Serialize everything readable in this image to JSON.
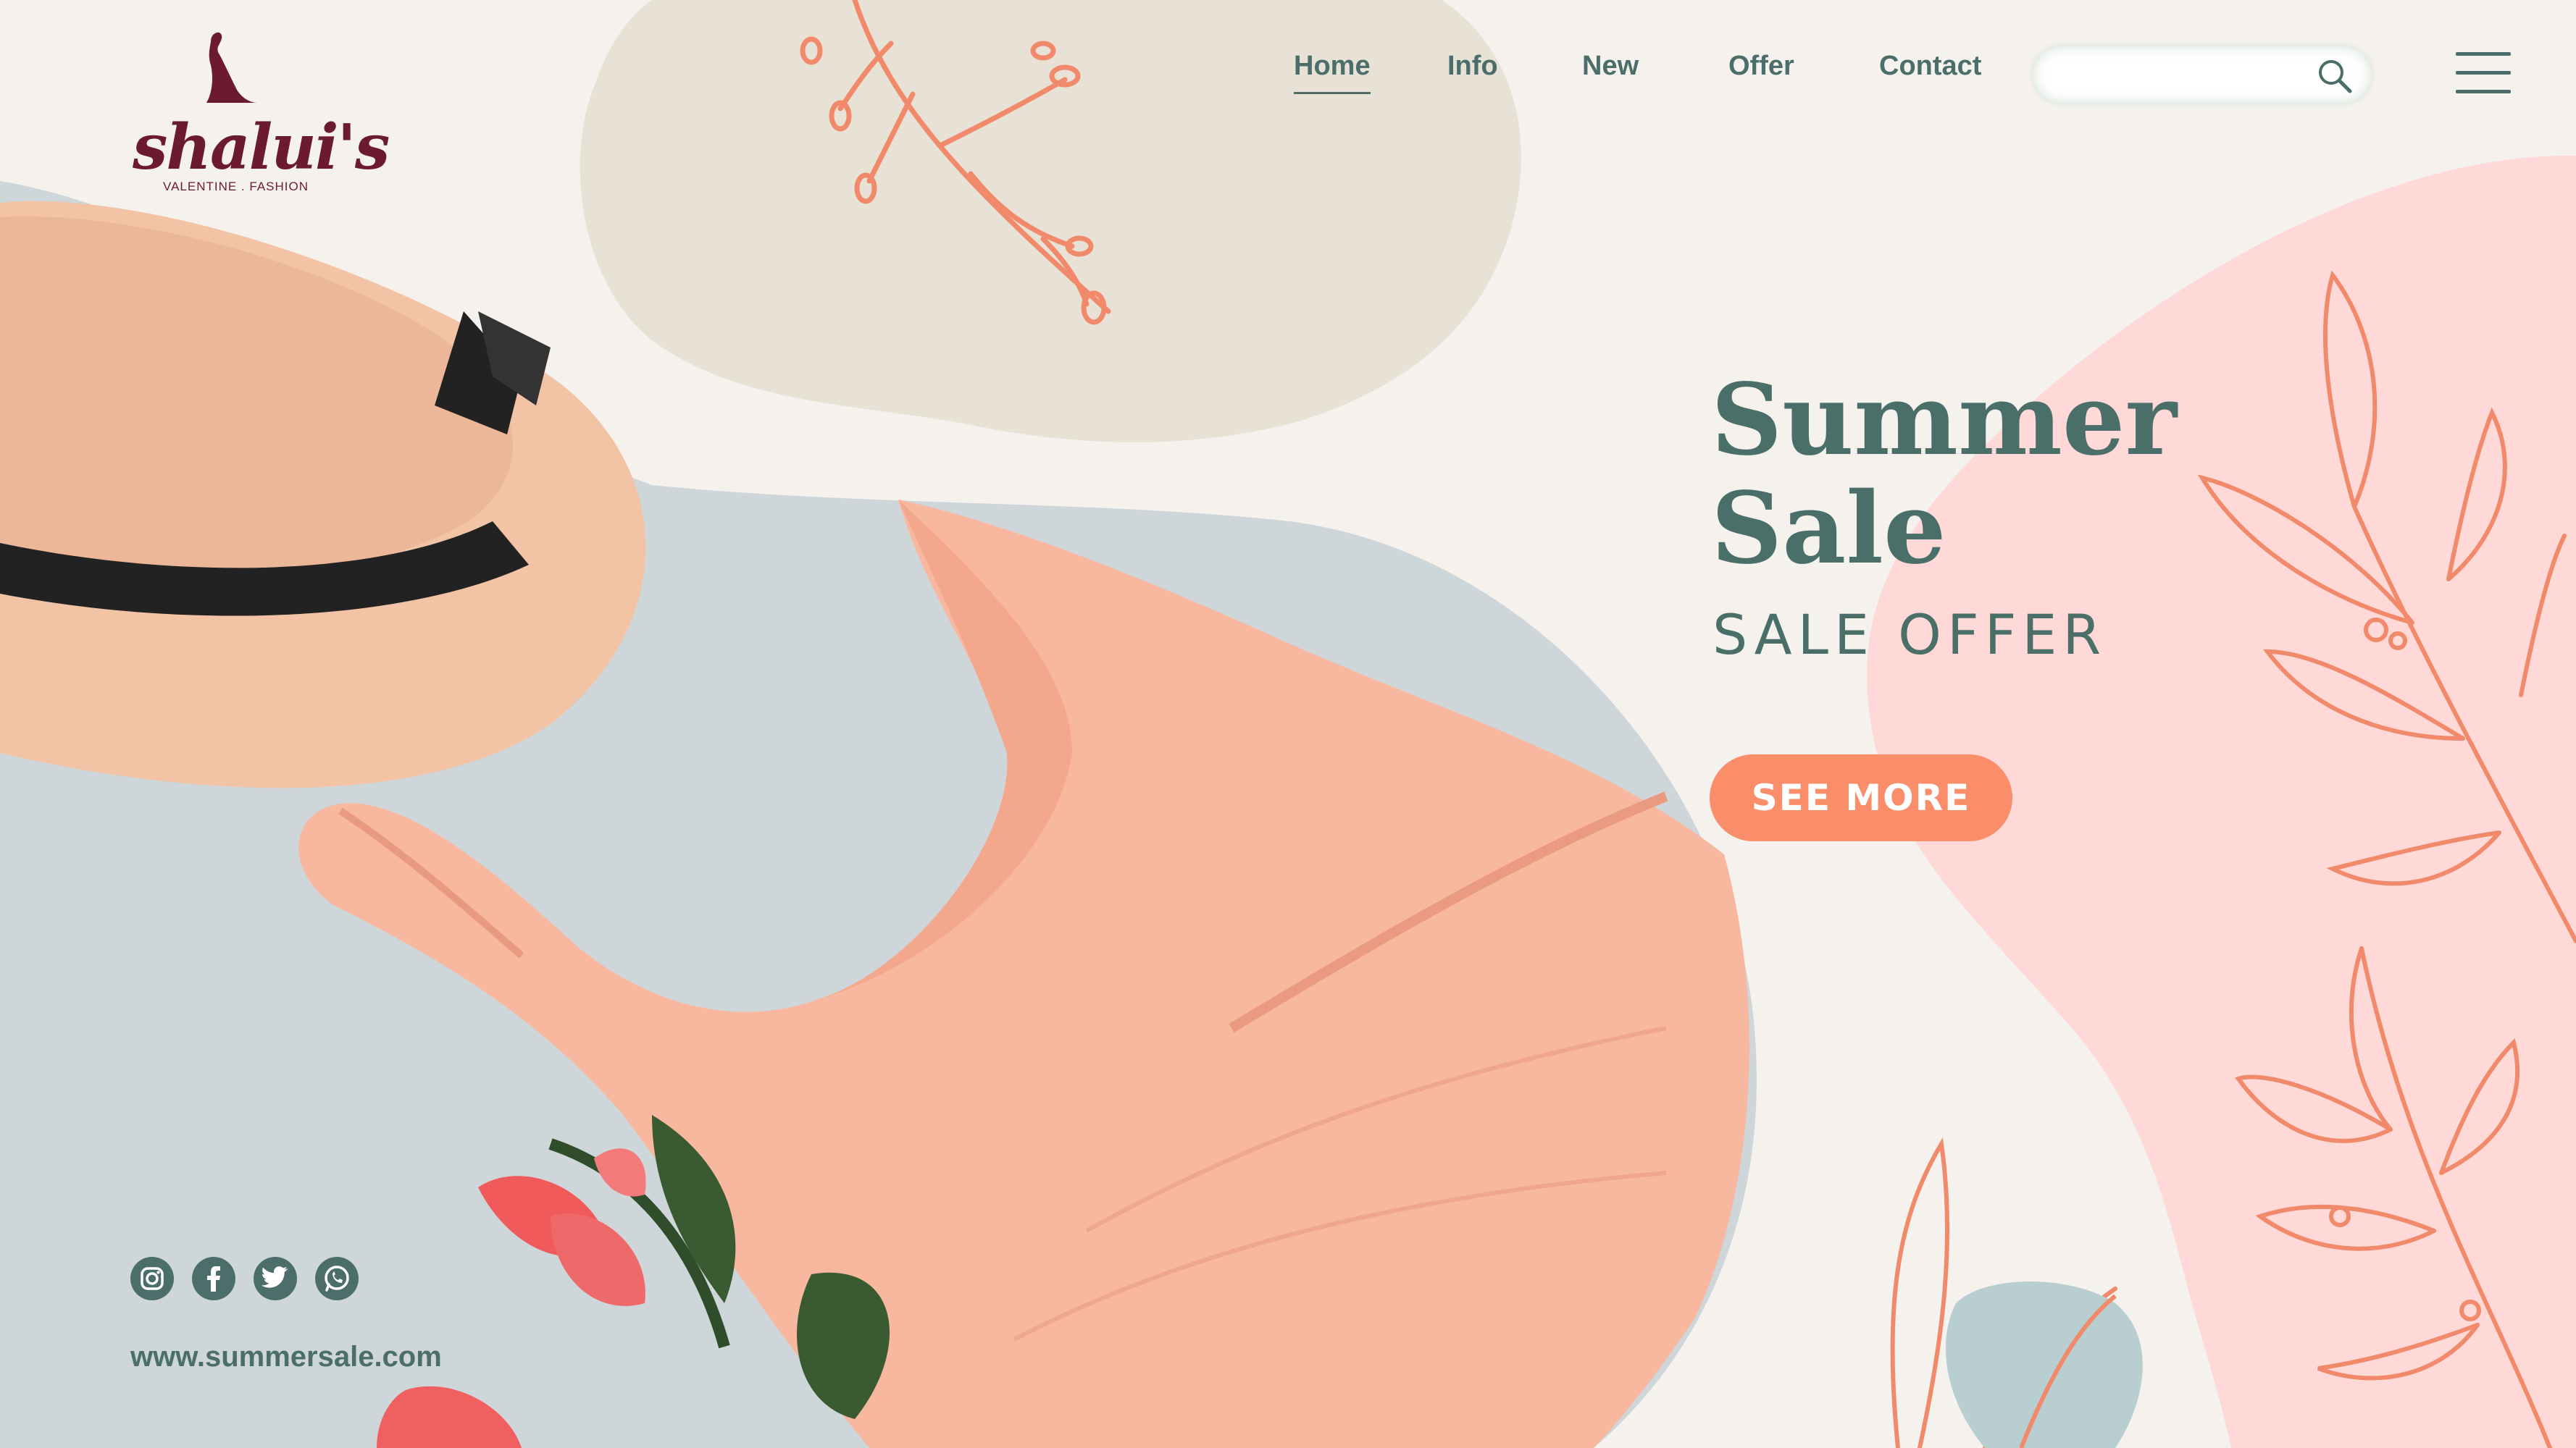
{
  "brand": {
    "name": "shalui's",
    "tagline": "VALENTINE . FASHION"
  },
  "nav": {
    "items": [
      {
        "label": "Home",
        "active": true
      },
      {
        "label": "Info",
        "active": false
      },
      {
        "label": "New",
        "active": false
      },
      {
        "label": "Offer",
        "active": false
      },
      {
        "label": "Contact",
        "active": false
      }
    ]
  },
  "search": {
    "value": "",
    "placeholder": "",
    "icon": "search-icon"
  },
  "menu": {
    "icon": "hamburger-menu-icon"
  },
  "hero": {
    "title_line1": "Summer",
    "title_line2": "Sale",
    "subtitle": "SALE OFFER",
    "cta_label": "SEE  MORE"
  },
  "social": {
    "icons": [
      "instagram-icon",
      "facebook-icon",
      "twitter-icon",
      "whatsapp-icon"
    ]
  },
  "footer": {
    "url": "www.summersale.com"
  },
  "colors": {
    "background": "#f5f2ee",
    "accent": "#fa8d6a",
    "text": "#4a6e68",
    "pink_blob": "#ffd8d8",
    "beige_blob": "#e8e2d6",
    "photo_bg": "#cfd6da",
    "dress": "#f8b8a0",
    "hat": "#f4c4a8",
    "brand": "#6b1a30"
  }
}
